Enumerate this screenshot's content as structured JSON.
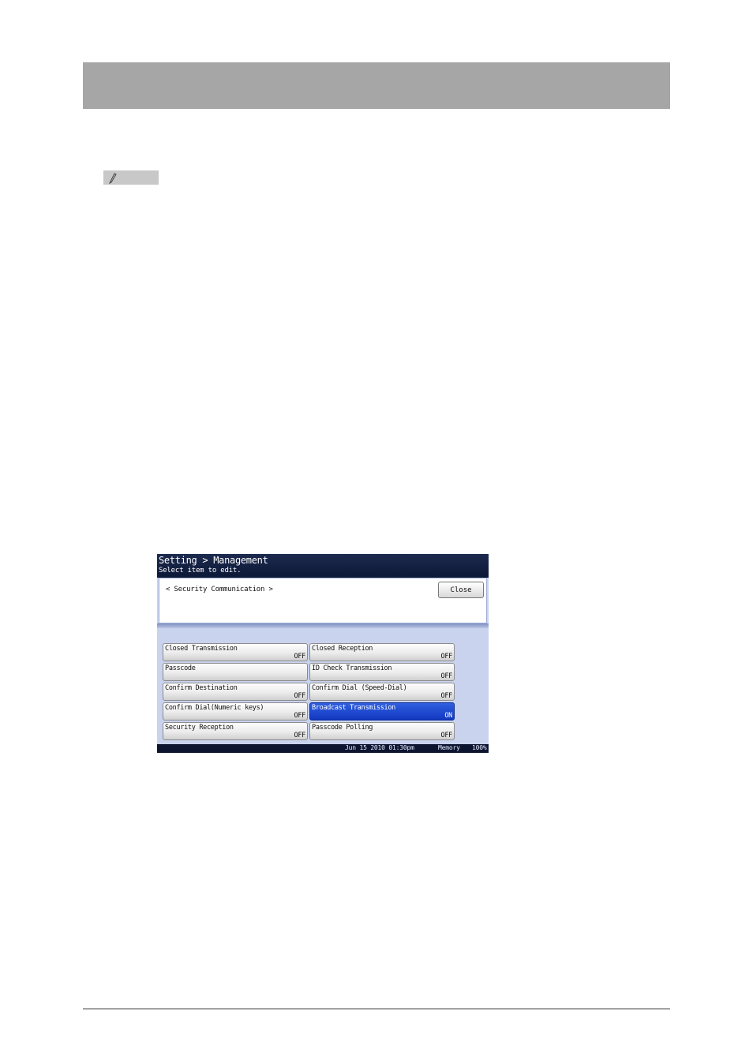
{
  "panel": {
    "title": "Setting > Management",
    "subtitle": "Select item to edit.",
    "breadcrumb": "< Security Communication  >",
    "close_label": "Close",
    "options": [
      {
        "label": "Closed Transmission",
        "value": "OFF"
      },
      {
        "label": "Closed Reception",
        "value": "OFF"
      },
      {
        "label": "Passcode",
        "value": ""
      },
      {
        "label": "ID Check Transmission",
        "value": "OFF"
      },
      {
        "label": "Confirm Destination",
        "value": "OFF"
      },
      {
        "label": "Confirm Dial (Speed-Dial)",
        "value": "OFF"
      },
      {
        "label": "Confirm Dial(Numeric keys)",
        "value": "OFF"
      },
      {
        "label": "Broadcast Transmission",
        "value": "ON"
      },
      {
        "label": "Security Reception",
        "value": "OFF"
      },
      {
        "label": "Passcode Polling",
        "value": "OFF"
      }
    ],
    "status": {
      "datetime": "Jun 15 2010 01:30pm",
      "memory_label": "Memory",
      "memory_value": "100%"
    }
  },
  "icons": {
    "note": "pencil-icon"
  },
  "colors": {
    "header_bar": "#a6a6a6",
    "selected_option": "#1a45d0",
    "panel_titlebar": "#0c1836"
  }
}
